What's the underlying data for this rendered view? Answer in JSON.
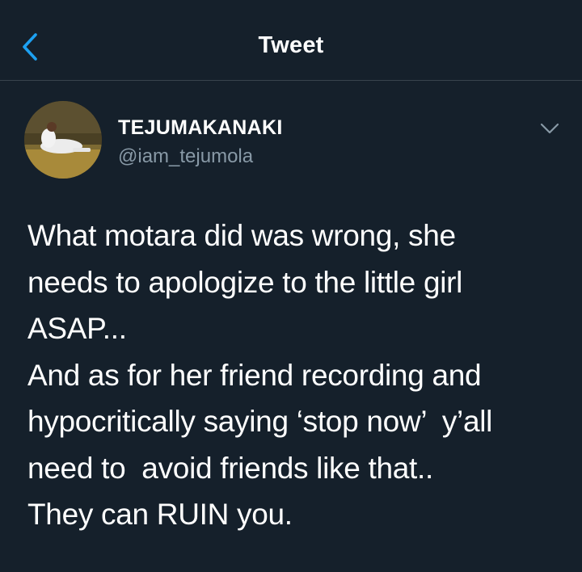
{
  "header": {
    "title": "Tweet",
    "back_icon": "chevron-left-icon"
  },
  "author": {
    "display_name": "TEJUMAKANAKI",
    "handle": "@iam_tejumola",
    "avatar": "avatar-photo",
    "menu_icon": "chevron-down-icon"
  },
  "tweet": {
    "lines": [
      "What motara did was wrong, she",
      "needs to apologize to the little girl",
      "ASAP...",
      "And as for her friend recording and",
      "hypocritically saying ‘stop now’  y’all",
      "need to  avoid friends like that..",
      "They can RUIN you."
    ]
  },
  "colors": {
    "background": "#15202b",
    "accent": "#1da1f2",
    "text": "#ffffff",
    "secondary_text": "#8899a6",
    "divider": "#38444d"
  }
}
